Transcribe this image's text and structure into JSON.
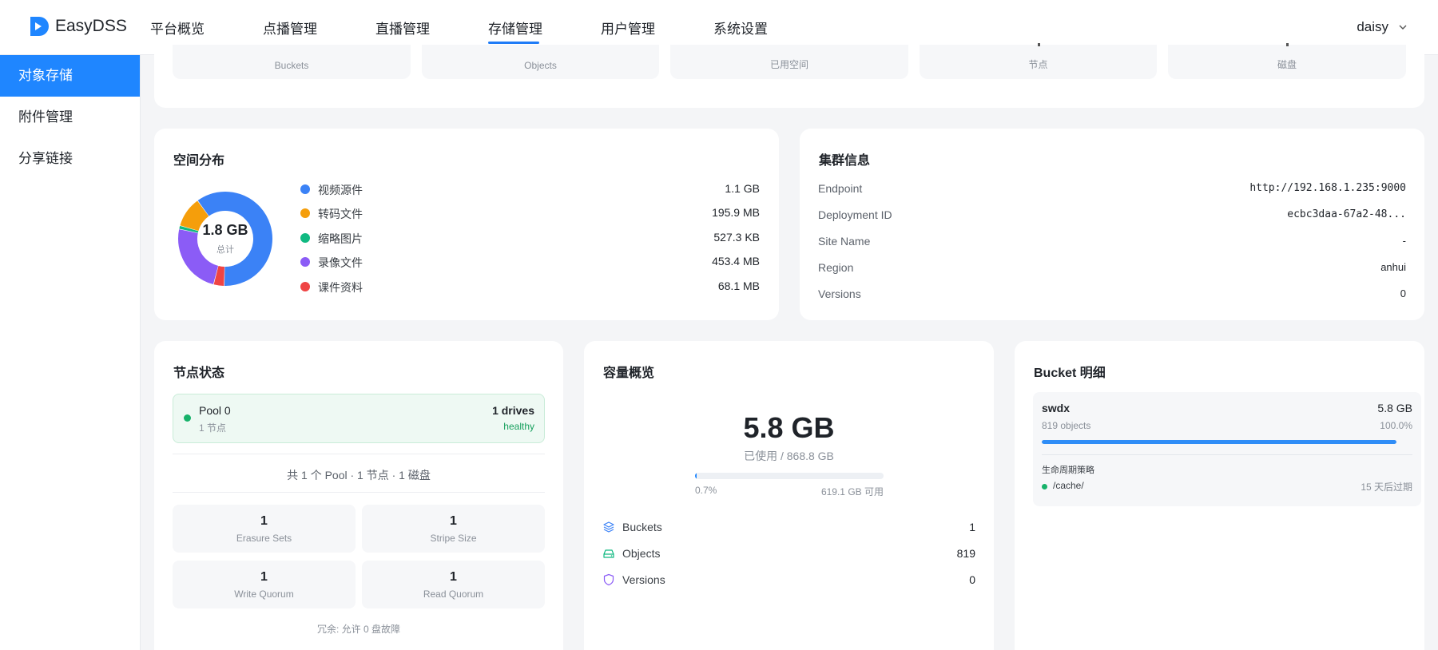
{
  "app": {
    "name": "EasyDSS",
    "brand_color": "#1f86ff"
  },
  "nav": {
    "items": [
      {
        "label": "平台概览"
      },
      {
        "label": "点播管理"
      },
      {
        "label": "直播管理"
      },
      {
        "label": "存储管理",
        "active": true
      },
      {
        "label": "用户管理"
      },
      {
        "label": "系统设置"
      }
    ]
  },
  "user": {
    "name": "daisy"
  },
  "sidebar": {
    "items": [
      {
        "label": "对象存储",
        "active": true
      },
      {
        "label": "附件管理"
      },
      {
        "label": "分享链接"
      }
    ]
  },
  "stats": {
    "labels": [
      "Buckets",
      "Objects",
      "已用空间",
      "节点",
      "磁盘"
    ]
  },
  "space": {
    "title": "空间分布",
    "total": "1.8 GB",
    "total_label": "总计",
    "legend": [
      {
        "name": "视频源件",
        "value": "1.1 GB",
        "color": "#3b82f6"
      },
      {
        "name": "转码文件",
        "value": "195.9 MB",
        "color": "#f59e0b"
      },
      {
        "name": "缩略图片",
        "value": "527.3 KB",
        "color": "#10b981"
      },
      {
        "name": "录像文件",
        "value": "453.4 MB",
        "color": "#8b5cf6"
      },
      {
        "name": "课件资料",
        "value": "68.1 MB",
        "color": "#ef4444"
      }
    ]
  },
  "chart_data": {
    "type": "pie",
    "title": "空间分布",
    "categories": [
      "视频源件",
      "转码文件",
      "缩略图片",
      "录像文件",
      "课件资料"
    ],
    "values": [
      1126.4,
      195.9,
      0.53,
      453.4,
      68.1
    ],
    "unit": "MB"
  },
  "cluster": {
    "title": "集群信息",
    "rows": [
      {
        "key": "Endpoint",
        "value": "http://192.168.1.235:9000"
      },
      {
        "key": "Deployment ID",
        "value": "ecbc3daa-67a2-48..."
      },
      {
        "key": "Site Name",
        "value": "-"
      },
      {
        "key": "Region",
        "value": "anhui"
      },
      {
        "key": "Versions",
        "value": "0"
      }
    ]
  },
  "nodes": {
    "title": "节点状态",
    "pool": {
      "name": "Pool 0",
      "sub": "1 节点",
      "drives": "1 drives",
      "health": "healthy",
      "status_color": "#17b26a"
    },
    "summary": "共 1 个 Pool · 1 节点 · 1 磁盘",
    "metrics": [
      {
        "value": "1",
        "label": "Erasure Sets"
      },
      {
        "value": "1",
        "label": "Stripe Size"
      },
      {
        "value": "1",
        "label": "Write Quorum"
      },
      {
        "value": "1",
        "label": "Read Quorum"
      }
    ],
    "redundancy": "冗余: 允许 0 盘故障"
  },
  "capacity": {
    "title": "容量概览",
    "used": "5.8 GB",
    "used_of": "已使用 / 868.8 GB",
    "percent_label": "0.7%",
    "percent": 0.007,
    "free": "619.1 GB 可用",
    "rows": [
      {
        "key": "Buckets",
        "value": "1",
        "icon": "layers-icon"
      },
      {
        "key": "Objects",
        "value": "819",
        "icon": "drive-icon"
      },
      {
        "key": "Versions",
        "value": "0",
        "icon": "shield-icon"
      }
    ]
  },
  "buckets": {
    "title": "Bucket 明细",
    "items": [
      {
        "name": "swdx",
        "size": "5.8 GB",
        "objects": "819 objects",
        "percent_label": "100.0%",
        "percent": 1.0,
        "lifecycle_title": "生命周期策略",
        "lifecycle_prefix": "/cache/",
        "lifecycle_expiry": "15 天后过期"
      }
    ]
  }
}
